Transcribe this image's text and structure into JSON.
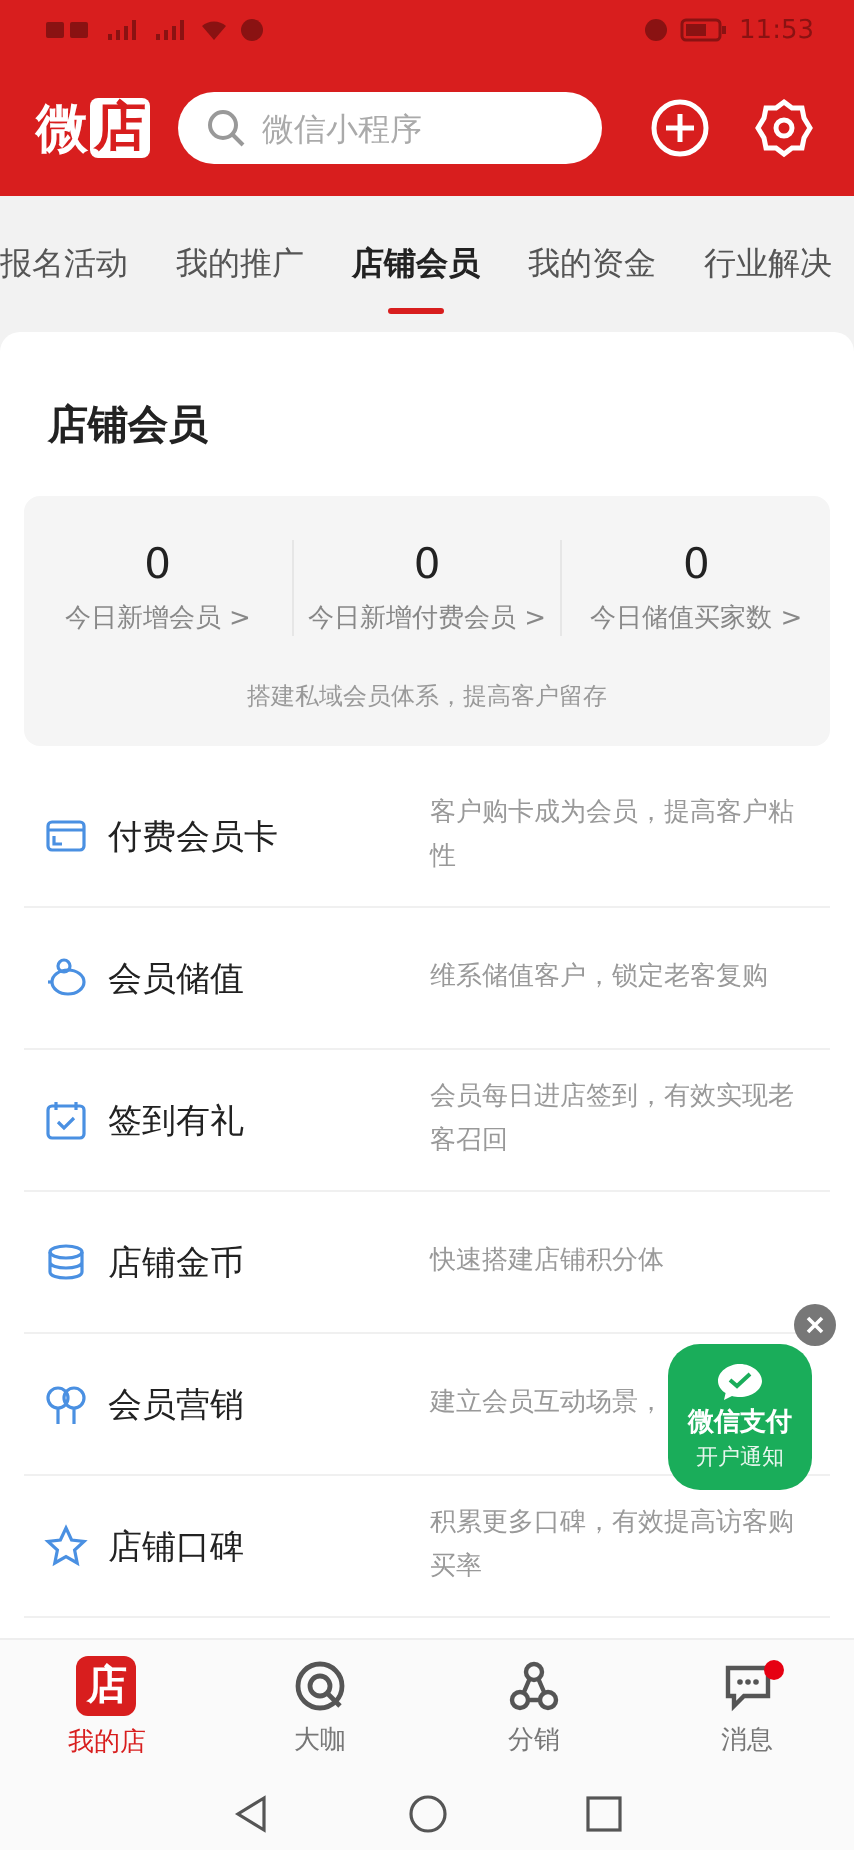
{
  "status_bar": {
    "time": "11:53"
  },
  "header": {
    "logo_text": "微",
    "logo_box_text": "店",
    "search": {
      "placeholder": "微信小程序"
    }
  },
  "tabs": [
    {
      "label": "报名活动",
      "selected": false
    },
    {
      "label": "我的推广",
      "selected": false
    },
    {
      "label": "店铺会员",
      "selected": true
    },
    {
      "label": "我的资金",
      "selected": false
    },
    {
      "label": "行业解决",
      "selected": false
    }
  ],
  "section": {
    "title": "店铺会员",
    "stats": [
      {
        "value": "0",
        "label": "今日新增会员 >"
      },
      {
        "value": "0",
        "label": "今日新增付费会员 >"
      },
      {
        "value": "0",
        "label": "今日储值买家数 >"
      }
    ],
    "stats_note": "搭建私域会员体系，提高客户留存"
  },
  "features": [
    {
      "title": "付费会员卡",
      "description": "客户购卡成为会员，提高客户粘性"
    },
    {
      "title": "会员储值",
      "description": "维系储值客户，锁定老客复购"
    },
    {
      "title": "签到有礼",
      "description": "会员每日进店签到，有效实现老客召回"
    },
    {
      "title": "店铺金币",
      "description": "快速搭建店铺积分体"
    },
    {
      "title": "会员营销",
      "description": "建立会员互动场景，"
    },
    {
      "title": "店铺口碑",
      "description": "积累更多口碑，有效提高访客购买率"
    }
  ],
  "promo_badge": {
    "title": "微信支付",
    "subtitle": "开户通知"
  },
  "bottom_nav": [
    {
      "label": "我的店",
      "selected": true,
      "dot": false,
      "glyph": "店"
    },
    {
      "label": "大咖",
      "selected": false,
      "dot": false
    },
    {
      "label": "分销",
      "selected": false,
      "dot": false
    },
    {
      "label": "消息",
      "selected": false,
      "dot": true
    }
  ]
}
